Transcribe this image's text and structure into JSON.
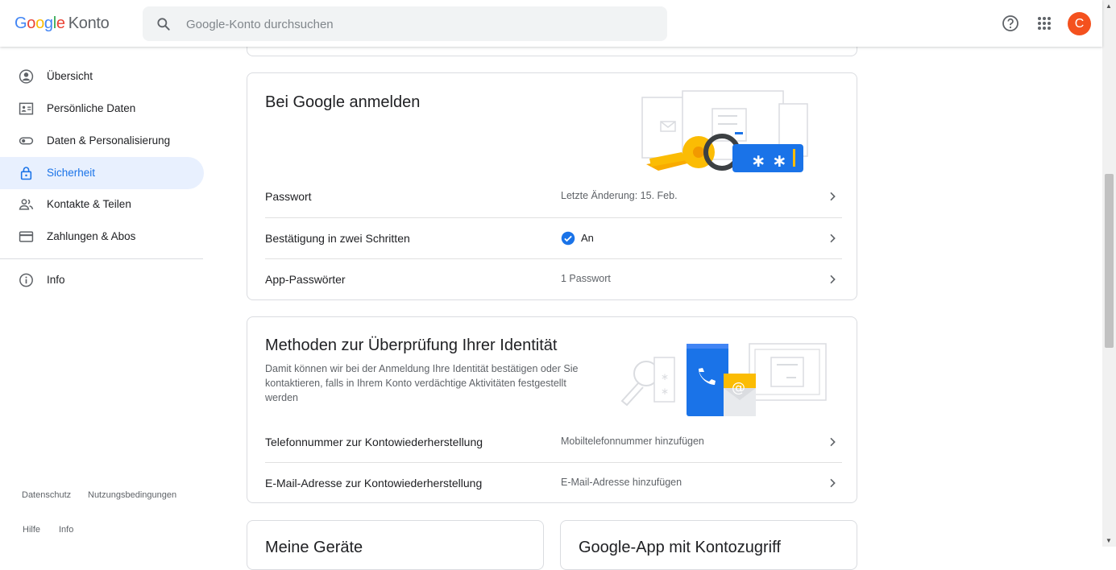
{
  "header": {
    "logo_google": [
      "G",
      "o",
      "o",
      "g",
      "l",
      "e"
    ],
    "logo_product": "Konto",
    "search_placeholder": "Google-Konto durchsuchen",
    "avatar_initial": "C"
  },
  "sidebar": {
    "items": [
      {
        "label": "Übersicht",
        "icon": "account-circle-icon",
        "active": false
      },
      {
        "label": "Persönliche Daten",
        "icon": "id-card-icon",
        "active": false
      },
      {
        "label": "Daten & Personalisierung",
        "icon": "toggle-icon",
        "active": false
      },
      {
        "label": "Sicherheit",
        "icon": "lock-icon",
        "active": true
      },
      {
        "label": "Kontakte & Teilen",
        "icon": "people-icon",
        "active": false
      },
      {
        "label": "Zahlungen & Abos",
        "icon": "credit-card-icon",
        "active": false
      }
    ],
    "info": {
      "label": "Info",
      "icon": "info-icon"
    },
    "footer_links": [
      "Datenschutz",
      "Nutzungsbedingungen",
      "Hilfe",
      "Info"
    ]
  },
  "signin_card": {
    "title": "Bei Google anmelden",
    "rows": [
      {
        "label": "Passwort",
        "value": "Letzte Änderung: 15. Feb."
      },
      {
        "label": "Bestätigung in zwei Schritten",
        "value": "An"
      },
      {
        "label": "App-Passwörter",
        "value": "1 Passwort"
      }
    ]
  },
  "identity_card": {
    "title": "Methoden zur Überprüfung Ihrer Identität",
    "description": "Damit können wir bei der Anmeldung Ihre Identität bestätigen oder Sie kontaktieren, falls in Ihrem Konto verdächtige Aktivitäten festgestellt werden",
    "rows": [
      {
        "label": "Telefonnummer zur Kontowiederherstellung",
        "value": "Mobiltelefonnummer hinzufügen"
      },
      {
        "label": "E-Mail-Adresse zur Kontowiederherstellung",
        "value": "E-Mail-Adresse hinzufügen"
      }
    ]
  },
  "bottom_cards": {
    "left_title": "Meine Geräte",
    "right_title": "Google-App mit Kontozugriff"
  },
  "colors": {
    "accent": "#1a73e8",
    "active_bg": "#e8f0fe",
    "avatar": "#f4511e"
  }
}
